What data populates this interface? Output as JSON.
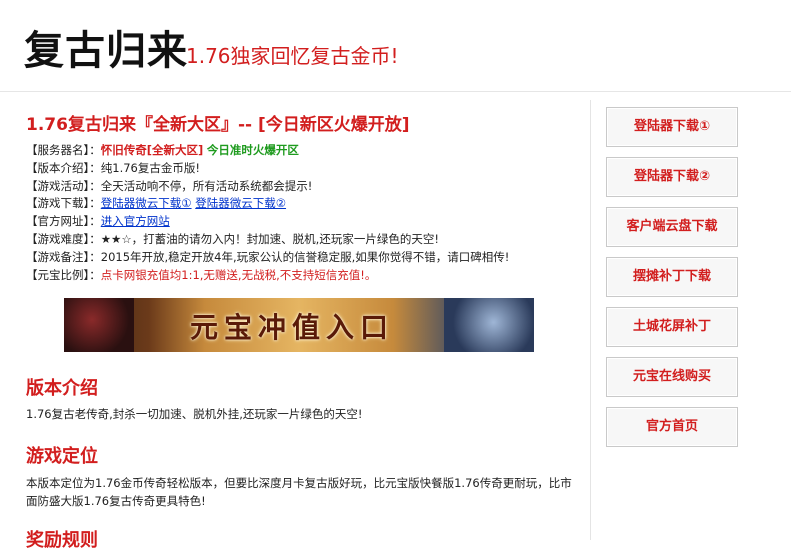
{
  "header": {
    "logo": "复古归来",
    "tagline": "1.76独家回忆复古金币!"
  },
  "main": {
    "title": "1.76复古归来『全新大区』-- [今日新区火爆开放]",
    "info": [
      {
        "label": "【服务器名】：",
        "value": "怀旧传奇[全新大区]",
        "value2": "今日准时火爆开区"
      },
      {
        "label": "【版本介绍】：",
        "value": "纯1.76复古金币版!"
      },
      {
        "label": "【游戏活动】：",
        "value": "全天活动响不停，所有活动系统都会提示!"
      },
      {
        "label": "【游戏下载】：",
        "link1": "登陆器微云下载①",
        "link2": "登陆器微云下载②"
      },
      {
        "label": "【官方网址】：",
        "link1": "进入官方网站"
      },
      {
        "label": "【游戏难度】：",
        "value": "★★☆，打蓄油的请勿入内！封加速、脱机,还玩家一片绿色的天空!"
      },
      {
        "label": "【游戏备注】：",
        "value": "2015年开放,稳定开放4年,玩家公认的信誉稳定服,如果你觉得不错，请口碑相传!"
      },
      {
        "label": "【元宝比例】：",
        "value": "点卡网银充值均1:1,无赠送,无战税,不支持短信充值!。"
      }
    ],
    "banner_text": "元宝冲值入口",
    "sections": [
      {
        "title": "版本介绍",
        "text": "1.76复古老传奇,封杀一切加速、脱机外挂,还玩家一片绿色的天空!"
      },
      {
        "title": "游戏定位",
        "text": "本版本定位为1.76金币传奇轻松版本，但要比深度月卡复古版好玩，比元宝版快餐版1.76传奇更耐玩，比市面防盛大版1.76复古传奇更具特色!"
      },
      {
        "title": "奖励规则",
        "text": ""
      }
    ]
  },
  "sidebar": {
    "buttons": [
      "登陆器下载①",
      "登陆器下载②",
      "客户端云盘下载",
      "摆摊补丁下载",
      "土城花屏补丁",
      "元宝在线购买",
      "官方首页"
    ]
  },
  "colors": {
    "accent": "#d21e1e",
    "green": "#1f9b1f",
    "link": "#0033cc"
  }
}
